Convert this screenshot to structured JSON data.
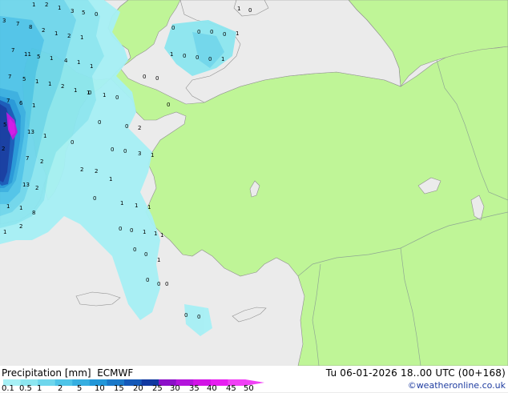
{
  "footer": {
    "product": "Precipitation [mm]",
    "model": "ECMWF",
    "valid_time": "Tu 06-01-2026 18..00 UTC (00+168)",
    "credit": "©weatheronline.co.uk"
  },
  "colorbar": {
    "labels": [
      "0.1",
      "0.5",
      "1",
      "2",
      "5",
      "10",
      "15",
      "20",
      "25",
      "30",
      "35",
      "40",
      "45",
      "50"
    ],
    "colors": [
      "#a6f0f5",
      "#8ce6f0",
      "#6ed6ec",
      "#4ec4e8",
      "#36aee0",
      "#2196d8",
      "#1a78c8",
      "#1458b8",
      "#1038a0",
      "#8c10c8",
      "#b414dc",
      "#d214e6",
      "#e61ef0",
      "#f040f5"
    ]
  },
  "colors": {
    "land_forecast": "#bff597",
    "land_other": "#ebebeb",
    "sea": "#ebebeb",
    "border": "#8fa892",
    "coast": "#8f8f8f"
  },
  "precip_values": [
    {
      "v": "1"
    },
    {
      "v": "2"
    },
    {
      "v": "1"
    },
    {
      "v": "3"
    },
    {
      "v": "5"
    },
    {
      "v": "0"
    },
    {
      "v": "3"
    },
    {
      "v": "7"
    },
    {
      "v": "8"
    },
    {
      "v": "2"
    },
    {
      "v": "1"
    },
    {
      "v": "2"
    },
    {
      "v": "1"
    },
    {
      "v": "7"
    },
    {
      "v": "11"
    },
    {
      "v": "5"
    },
    {
      "v": "1"
    },
    {
      "v": "4"
    },
    {
      "v": "1"
    },
    {
      "v": "1"
    },
    {
      "v": "7"
    },
    {
      "v": "5"
    },
    {
      "v": "1"
    },
    {
      "v": "1"
    },
    {
      "v": "2"
    },
    {
      "v": "1"
    },
    {
      "v": "1"
    },
    {
      "v": "7"
    },
    {
      "v": "6"
    },
    {
      "v": "1"
    },
    {
      "v": "5"
    },
    {
      "v": "13"
    },
    {
      "v": "1"
    },
    {
      "v": "2"
    },
    {
      "v": "7"
    },
    {
      "v": "2"
    },
    {
      "v": "13"
    },
    {
      "v": "2"
    },
    {
      "v": "8"
    },
    {
      "v": "1"
    },
    {
      "v": "1"
    },
    {
      "v": "2"
    },
    {
      "v": "1"
    },
    {
      "v": "1"
    },
    {
      "v": "0"
    },
    {
      "v": "0"
    },
    {
      "v": "0"
    },
    {
      "v": "0"
    },
    {
      "v": "0"
    },
    {
      "v": "1"
    },
    {
      "v": "1"
    },
    {
      "v": "0"
    },
    {
      "v": "0"
    },
    {
      "v": "0"
    },
    {
      "v": "1"
    },
    {
      "v": "0"
    },
    {
      "v": "0"
    },
    {
      "v": "0"
    },
    {
      "v": "0"
    },
    {
      "v": "1"
    },
    {
      "v": "0"
    },
    {
      "v": "0"
    },
    {
      "v": "0"
    },
    {
      "v": "2"
    },
    {
      "v": "0"
    },
    {
      "v": "0"
    },
    {
      "v": "0"
    },
    {
      "v": "3"
    },
    {
      "v": "1"
    },
    {
      "v": "2"
    },
    {
      "v": "2"
    },
    {
      "v": "1"
    },
    {
      "v": "0"
    },
    {
      "v": "1"
    },
    {
      "v": "1"
    },
    {
      "v": "1"
    },
    {
      "v": "0"
    },
    {
      "v": "0"
    },
    {
      "v": "1"
    },
    {
      "v": "1"
    },
    {
      "v": "1"
    },
    {
      "v": "1"
    },
    {
      "v": "0"
    },
    {
      "v": "0"
    },
    {
      "v": "0"
    },
    {
      "v": "0"
    },
    {
      "v": "0"
    },
    {
      "v": "0"
    },
    {
      "v": "0"
    }
  ]
}
